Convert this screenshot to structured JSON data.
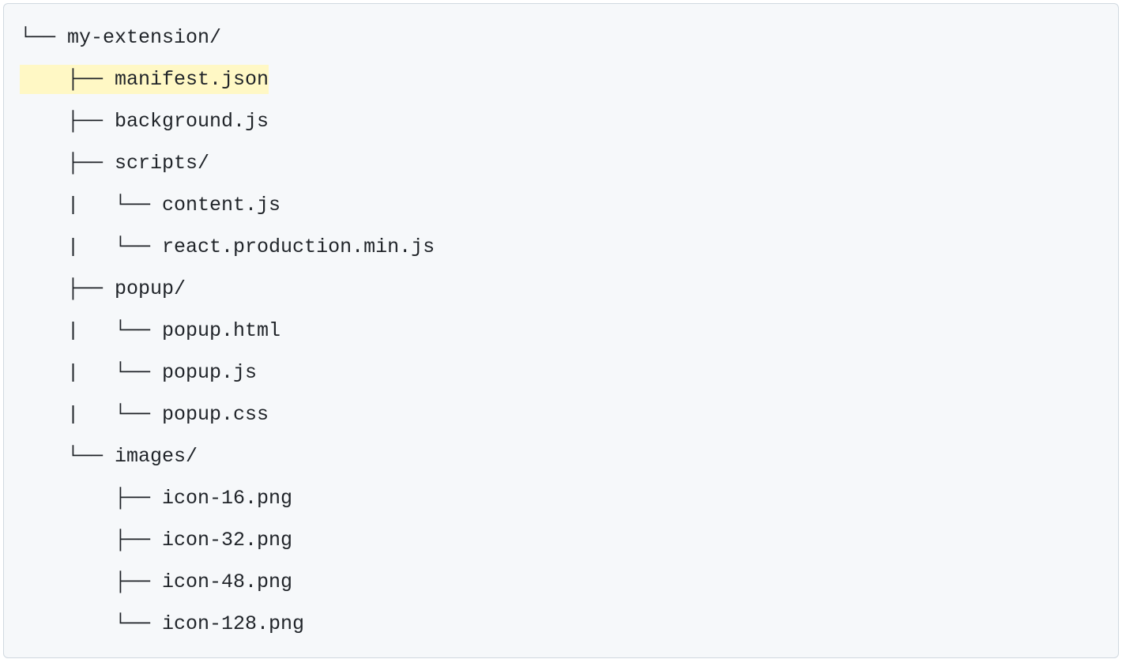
{
  "tree": {
    "lines": [
      {
        "prefix": "└── ",
        "name": "my-extension/",
        "highlighted": false
      },
      {
        "prefix": "    ├── ",
        "name": "manifest.json",
        "highlighted": true
      },
      {
        "prefix": "    ├── ",
        "name": "background.js",
        "highlighted": false
      },
      {
        "prefix": "    ├── ",
        "name": "scripts/",
        "highlighted": false
      },
      {
        "prefix": "    |   └── ",
        "name": "content.js",
        "highlighted": false
      },
      {
        "prefix": "    |   └── ",
        "name": "react.production.min.js",
        "highlighted": false
      },
      {
        "prefix": "    ├── ",
        "name": "popup/",
        "highlighted": false
      },
      {
        "prefix": "    |   └── ",
        "name": "popup.html",
        "highlighted": false
      },
      {
        "prefix": "    |   └── ",
        "name": "popup.js",
        "highlighted": false
      },
      {
        "prefix": "    |   └── ",
        "name": "popup.css",
        "highlighted": false
      },
      {
        "prefix": "    └── ",
        "name": "images/",
        "highlighted": false
      },
      {
        "prefix": "        ├── ",
        "name": "icon-16.png",
        "highlighted": false
      },
      {
        "prefix": "        ├── ",
        "name": "icon-32.png",
        "highlighted": false
      },
      {
        "prefix": "        ├── ",
        "name": "icon-48.png",
        "highlighted": false
      },
      {
        "prefix": "        └── ",
        "name": "icon-128.png",
        "highlighted": false
      }
    ]
  }
}
